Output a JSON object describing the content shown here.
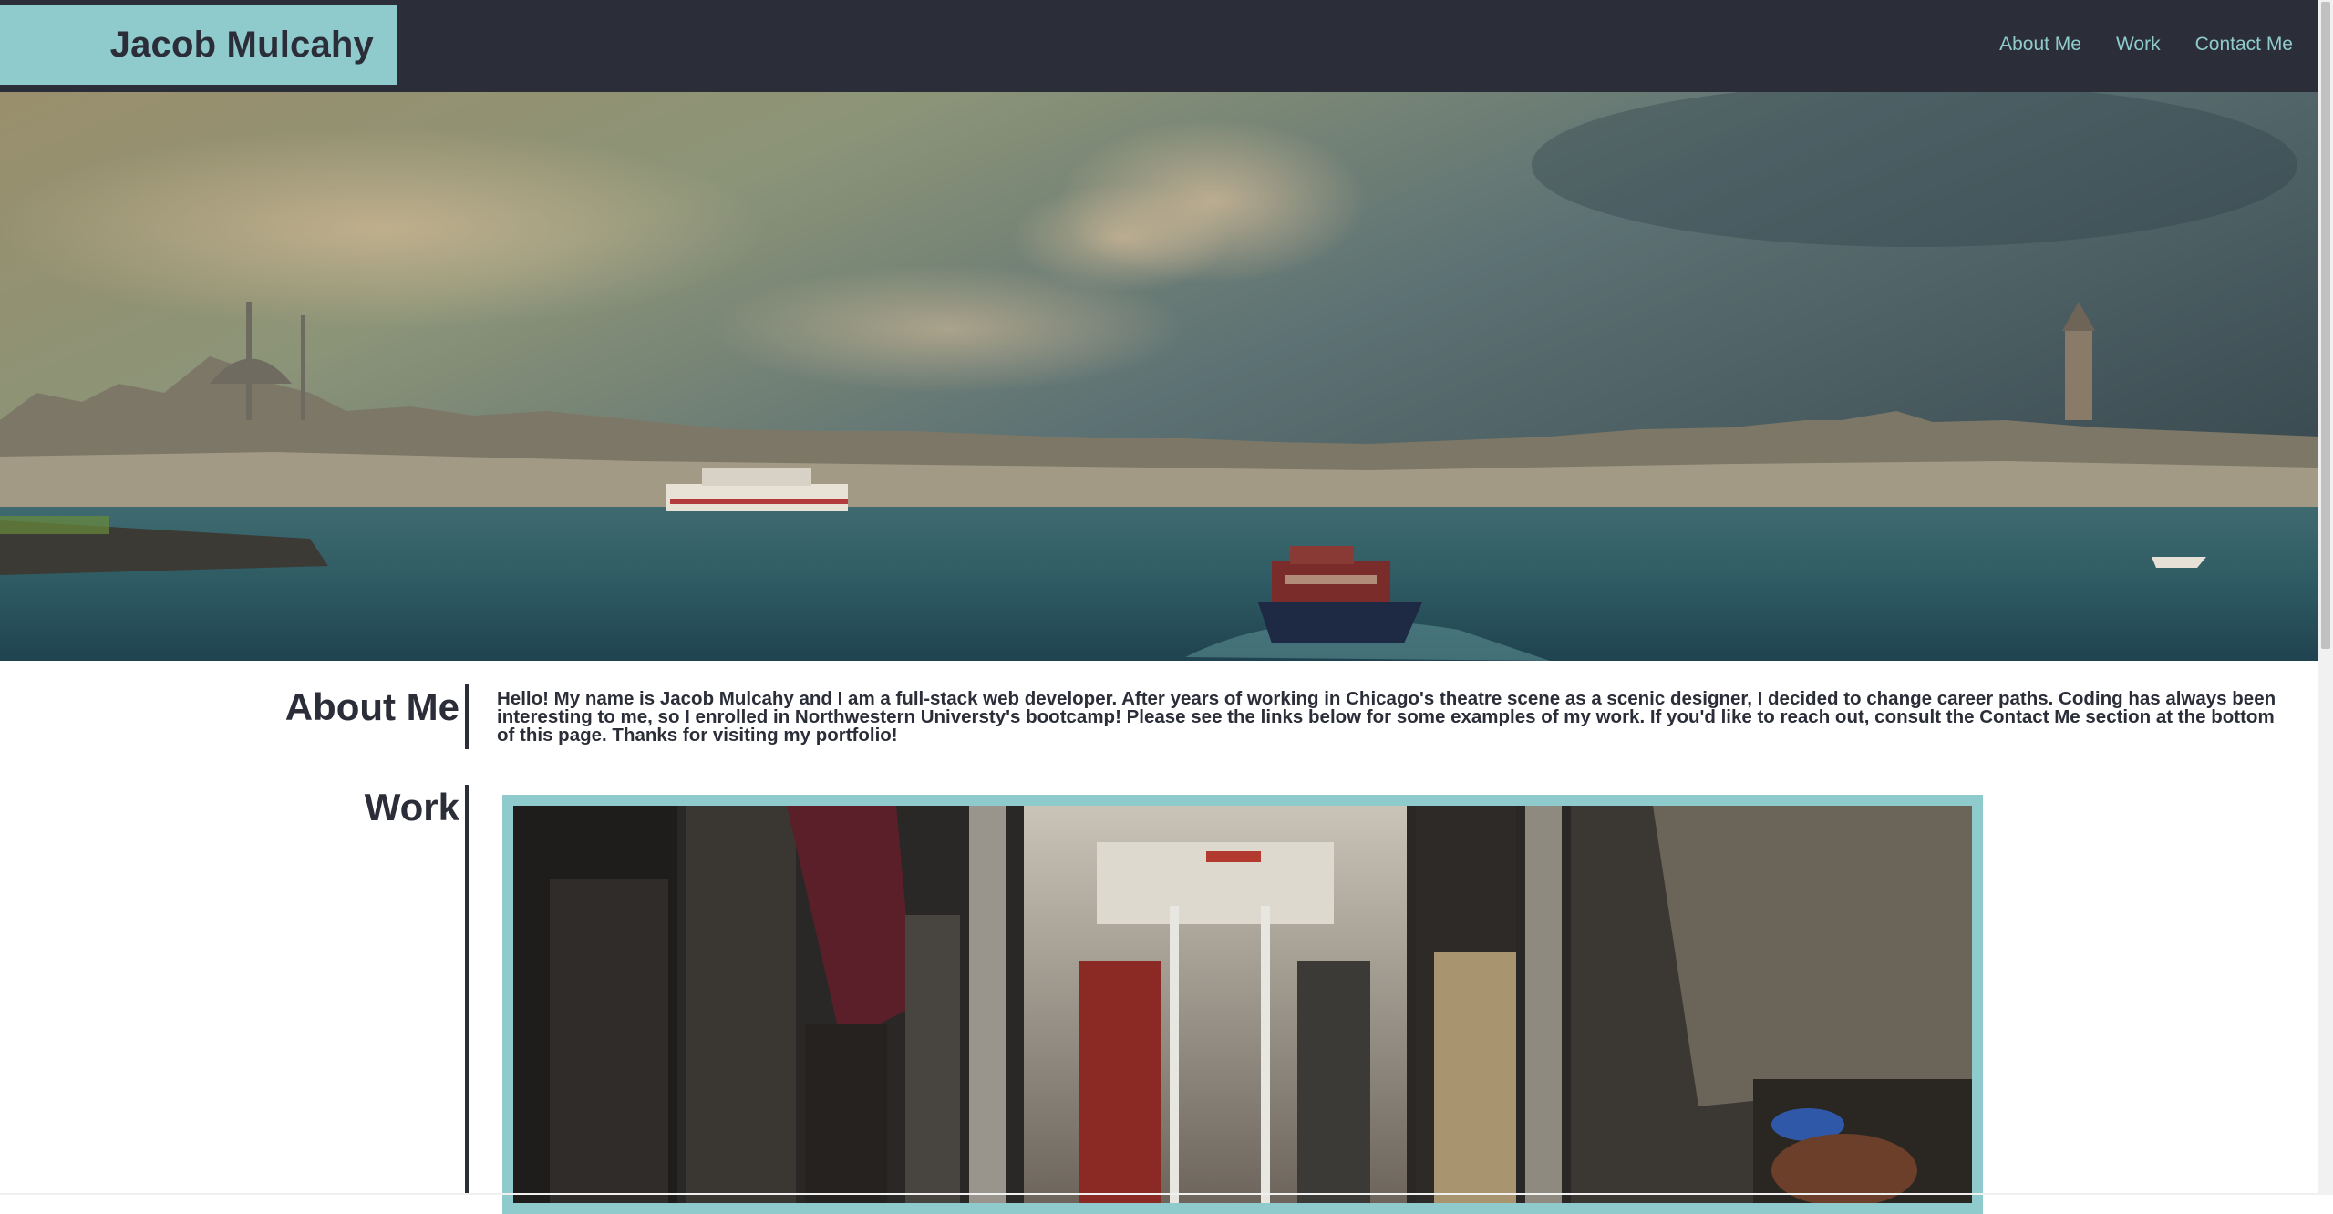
{
  "header": {
    "brand": "Jacob Mulcahy",
    "nav": [
      "About Me",
      "Work",
      "Contact Me"
    ]
  },
  "hero": {
    "image": "city-waterfront-with-ferries"
  },
  "about": {
    "title": "About Me",
    "text": "Hello! My name is Jacob Mulcahy and I am a full-stack web developer. After years of working in Chicago's theatre scene as a scenic designer, I decided to change career paths. Coding has always been interesting to me, so I enrolled in Northwestern Universty's bootcamp! Please see the links below for some examples of my work. If you'd like to reach out, consult the Contact Me section at the bottom of this page. Thanks for visiting my portfolio!"
  },
  "work": {
    "title": "Work",
    "image": "commuters-on-train"
  },
  "colors": {
    "header_bg": "#2b2e38",
    "accent": "#8fcbcd",
    "text": "#2b2e38",
    "page_bg": "#ffffff"
  }
}
